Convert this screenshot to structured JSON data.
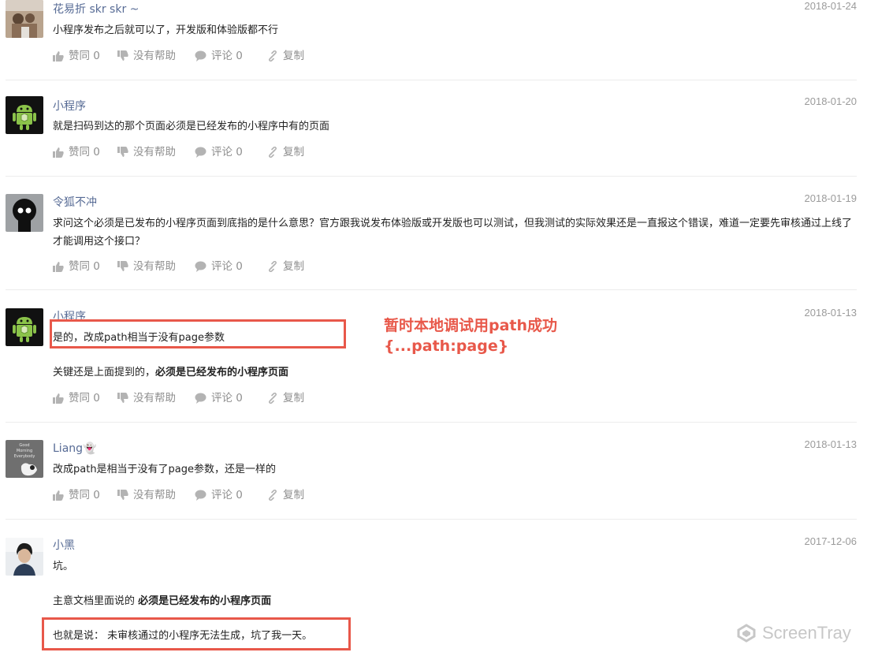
{
  "action_labels": {
    "agree": "赞同 0",
    "unhelpful": "没有帮助",
    "comment": "评论 0",
    "copy": "复制"
  },
  "comments": [
    {
      "author": "花易折 skr skr ~",
      "date": "2018-01-24",
      "paragraphs": [
        "小程序发布之后就可以了，开发版和体验版都不行"
      ]
    },
    {
      "author": "小程序",
      "date": "2018-01-20",
      "paragraphs": [
        "就是扫码到达的那个页面必须是已经发布的小程序中有的页面"
      ]
    },
    {
      "author": "令狐不冲",
      "date": "2018-01-19",
      "paragraphs": [
        "求问这个必须是已发布的小程序页面到底指的是什么意思？官方跟我说发布体验版或开发版也可以测试，但我测试的实际效果还是一直报这个错误，难道一定要先审核通过上线了才能调用这个接口？"
      ]
    },
    {
      "author": "小程序",
      "date": "2018-01-13",
      "paragraphs": [
        "是的，改成path相当于没有page参数"
      ],
      "rich_prefix": "关键还是上面提到的，",
      "rich_bold": "必须是已经发布的小程序页面"
    },
    {
      "author": "Liang👻",
      "date": "2018-01-13",
      "paragraphs": [
        "改成path是相当于没有了page参数，还是一样的"
      ],
      "avatar_text": [
        "Good",
        "Morning",
        "Everybody"
      ]
    },
    {
      "author": "小黑",
      "date": "2017-12-06",
      "paragraphs": [
        "坑。"
      ],
      "rich_prefix": "主意文档里面说的 ",
      "rich_bold": "必须是已经发布的小程序页面",
      "last_paragraph": "也就是说： 未审核通过的小程序无法生成，坑了我一天。"
    }
  ],
  "annotation": {
    "line1": "暂时本地调试用path成功",
    "line2": "{...path:page}"
  },
  "watermark": "ScreenTray",
  "colors": {
    "author": "#576b95",
    "date": "#9b9b9b",
    "action": "#8f8f8f",
    "annotation": "#e8584a",
    "divider": "#ececec"
  }
}
